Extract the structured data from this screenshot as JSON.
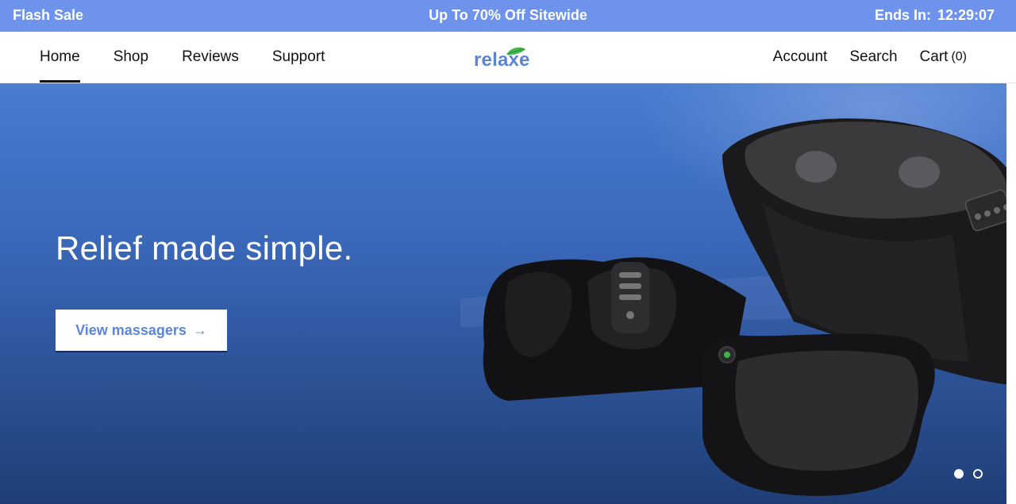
{
  "announcement": {
    "left_label": "Flash Sale",
    "center_label": "Up To 70% Off Sitewide",
    "ends_label": "Ends In:",
    "timer": "12:29:07"
  },
  "nav": {
    "left": [
      "Home",
      "Shop",
      "Reviews",
      "Support"
    ],
    "active": "Home",
    "account": "Account",
    "search": "Search",
    "cart_label": "Cart",
    "cart_count": "(0)"
  },
  "logo": {
    "text": "relaxe",
    "color": "#5b84d8",
    "leaf_color": "#44b44b"
  },
  "hero": {
    "title": "Relief made simple.",
    "button_label": "View massagers",
    "button_arrow": "→",
    "slides": 2,
    "active_slide": 1
  },
  "colors": {
    "announcement_bg": "#6e93ec",
    "hero_top": "#4a7cd0",
    "hero_bottom": "#1f3e76",
    "button_text": "#5d86d6"
  }
}
